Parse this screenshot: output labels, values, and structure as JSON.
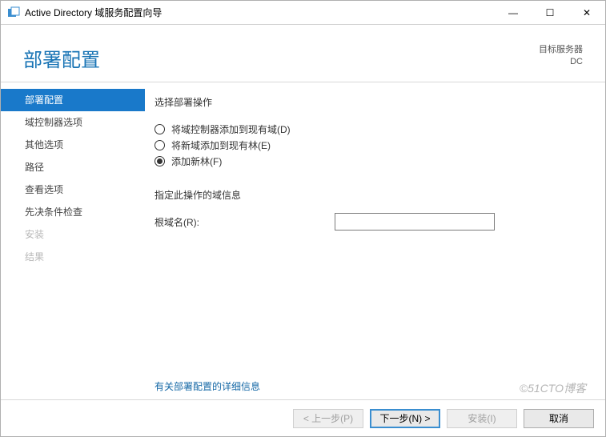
{
  "window": {
    "title": "Active Directory 域服务配置向导",
    "min": "—",
    "max": "☐",
    "close": "✕"
  },
  "header": {
    "page_title": "部署配置",
    "target_label": "目标服务器",
    "target_value": "DC"
  },
  "sidebar": {
    "items": [
      {
        "label": "部署配置",
        "state": "active"
      },
      {
        "label": "域控制器选项",
        "state": "normal"
      },
      {
        "label": "其他选项",
        "state": "normal"
      },
      {
        "label": "路径",
        "state": "normal"
      },
      {
        "label": "查看选项",
        "state": "normal"
      },
      {
        "label": "先决条件检查",
        "state": "normal"
      },
      {
        "label": "安装",
        "state": "disabled"
      },
      {
        "label": "结果",
        "state": "disabled"
      }
    ]
  },
  "content": {
    "select_op_label": "选择部署操作",
    "radios": [
      {
        "label": "将域控制器添加到现有域(D)",
        "checked": false
      },
      {
        "label": "将新域添加到现有林(E)",
        "checked": false
      },
      {
        "label": "添加新林(F)",
        "checked": true
      }
    ],
    "domain_info_label": "指定此操作的域信息",
    "root_domain_label": "根域名(R):",
    "root_domain_value": "",
    "more_info": "有关部署配置的详细信息"
  },
  "footer": {
    "prev": "< 上一步(P)",
    "next": "下一步(N) >",
    "install": "安装(I)",
    "cancel": "取消"
  },
  "watermark": "©51CTO博客"
}
